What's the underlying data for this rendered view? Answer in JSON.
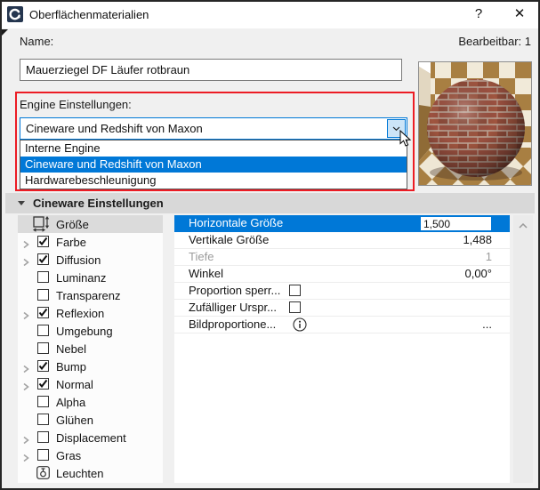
{
  "window": {
    "title": "Oberflächenmaterialien",
    "help_label": "?",
    "close_label": "✕"
  },
  "header": {
    "name_label": "Name:",
    "editable_label": "Bearbeitbar: 1",
    "name_value": "Mauerziegel DF Läufer rotbraun"
  },
  "engine": {
    "label": "Engine Einstellungen:",
    "selected": "Cineware und Redshift von Maxon",
    "options": [
      "Interne Engine",
      "Cineware und Redshift von Maxon",
      "Hardwarebeschleunigung"
    ],
    "highlighted_index": 1
  },
  "section": {
    "title": "Cineware Einstellungen"
  },
  "tree": {
    "items": [
      {
        "label": "Größe",
        "icon": "size-icon",
        "selected": true
      },
      {
        "label": "Farbe",
        "expandable": true,
        "checked": true
      },
      {
        "label": "Diffusion",
        "expandable": true,
        "checked": true
      },
      {
        "label": "Luminanz",
        "checked": false
      },
      {
        "label": "Transparenz",
        "checked": false
      },
      {
        "label": "Reflexion",
        "expandable": true,
        "checked": true
      },
      {
        "label": "Umgebung",
        "checked": false
      },
      {
        "label": "Nebel",
        "checked": false
      },
      {
        "label": "Bump",
        "expandable": true,
        "checked": true
      },
      {
        "label": "Normal",
        "expandable": true,
        "checked": true
      },
      {
        "label": "Alpha",
        "checked": false
      },
      {
        "label": "Glühen",
        "checked": false
      },
      {
        "label": "Displacement",
        "expandable": true,
        "checked": false
      },
      {
        "label": "Gras",
        "expandable": true,
        "checked": false
      },
      {
        "label": "Leuchten",
        "icon": "lamp-icon"
      }
    ]
  },
  "params": {
    "rows": [
      {
        "label": "Horizontale Größe",
        "value": "1,500",
        "control": "edit",
        "state": "selected"
      },
      {
        "label": "Vertikale Größe",
        "value": "1,488",
        "control": "text"
      },
      {
        "label": "Tiefe",
        "value": "1",
        "control": "text",
        "state": "disabled"
      },
      {
        "label": "Winkel",
        "value": "0,00°",
        "control": "text"
      },
      {
        "label": "Proportion sperr...",
        "control": "checkbox",
        "checked": false
      },
      {
        "label": "Zufälliger Urspr...",
        "control": "checkbox",
        "checked": false
      },
      {
        "label": "Bildproportione...",
        "control": "info",
        "value": "..."
      }
    ]
  },
  "colors": {
    "accent_blue": "#0078d7",
    "highlight_red": "#ec1c24",
    "selection_text": "#ffffff"
  }
}
